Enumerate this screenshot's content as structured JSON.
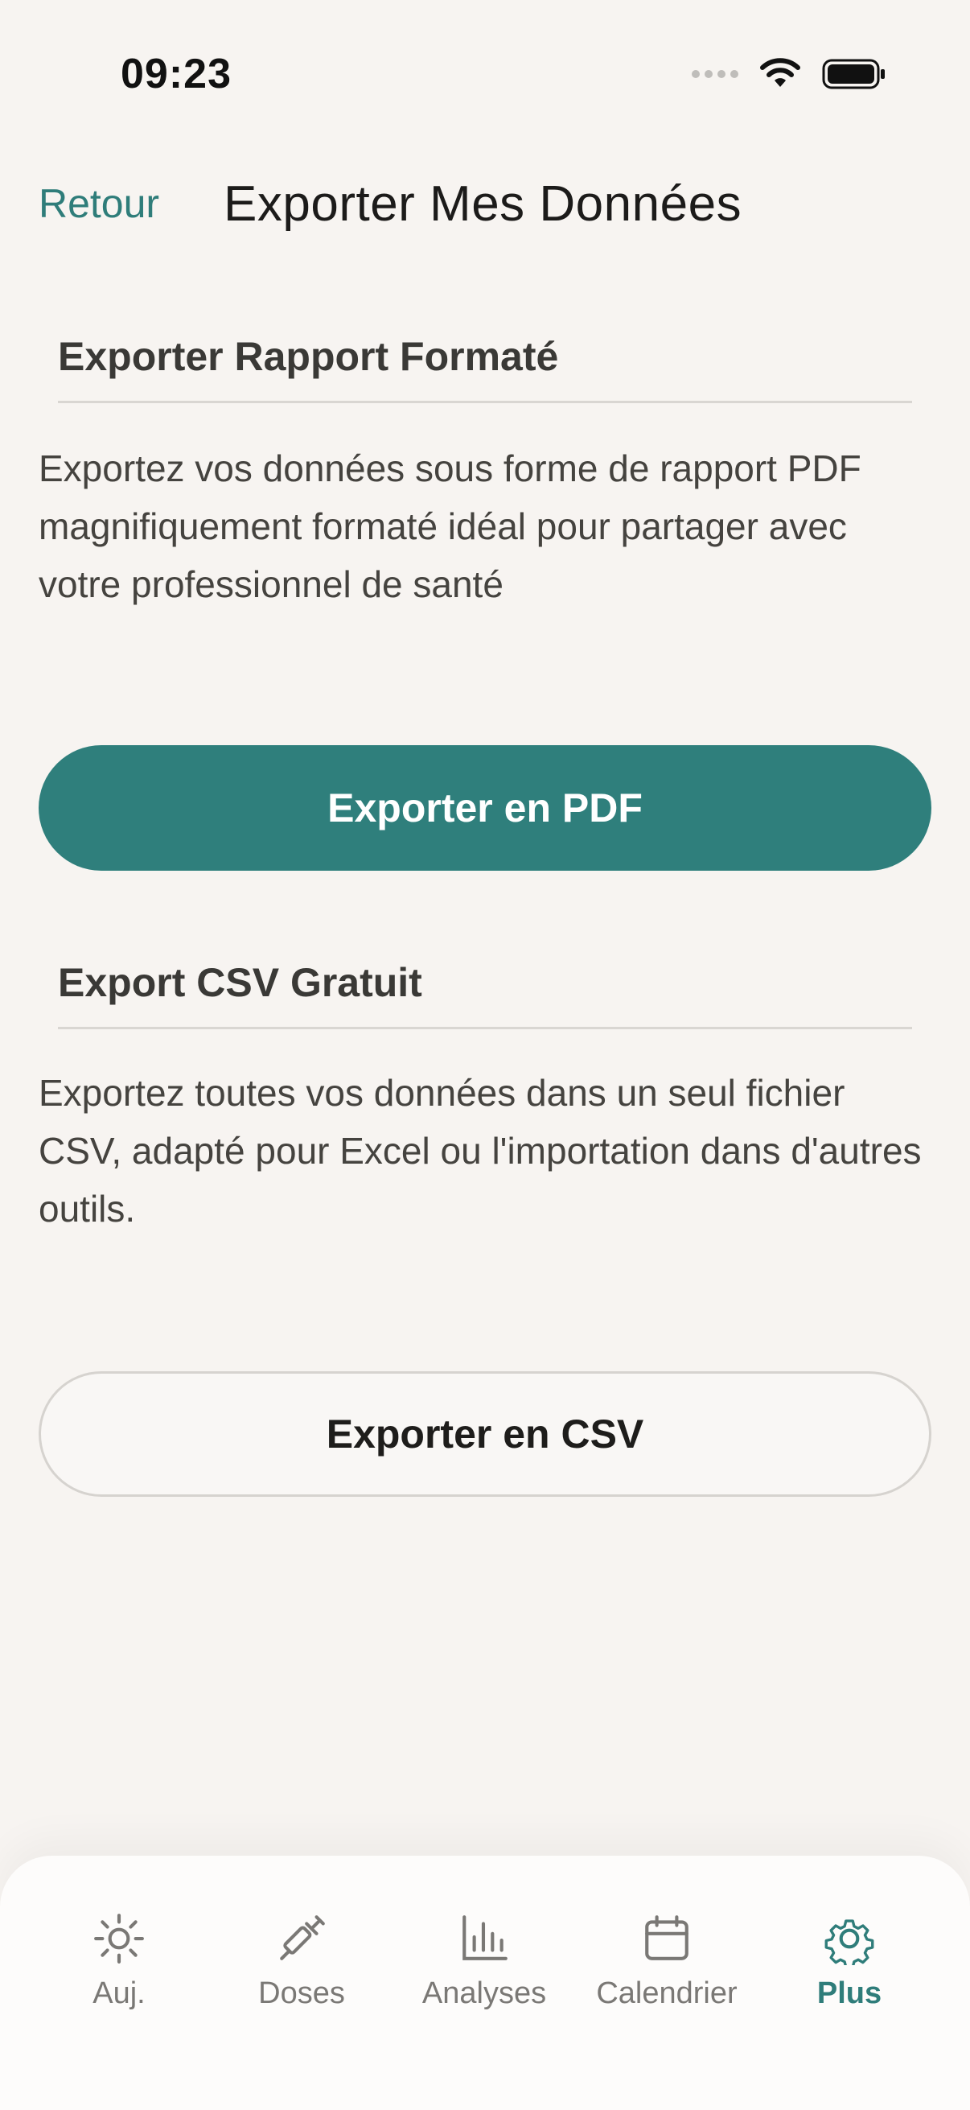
{
  "status_bar": {
    "time": "09:23"
  },
  "header": {
    "back_label": "Retour",
    "title": "Exporter Mes Données"
  },
  "sections": [
    {
      "heading": "Exporter Rapport Formaté",
      "description": "Exportez vos données sous forme de rapport PDF magnifiquement formaté idéal pour partager avec votre professionnel de santé",
      "button_label": "Exporter en PDF"
    },
    {
      "heading": "Export CSV Gratuit",
      "description": "Exportez toutes vos données dans un seul fichier CSV, adapté pour Excel ou l'importation dans d'autres outils.",
      "button_label": "Exporter en CSV"
    }
  ],
  "tab_bar": {
    "items": [
      {
        "label": "Auj.",
        "icon": "sun-icon"
      },
      {
        "label": "Doses",
        "icon": "syringe-icon"
      },
      {
        "label": "Analyses",
        "icon": "bar-chart-icon"
      },
      {
        "label": "Calendrier",
        "icon": "calendar-icon"
      },
      {
        "label": "Plus",
        "icon": "gear-icon"
      }
    ],
    "active_index": 4
  },
  "colors": {
    "accent": "#2f7d7a",
    "background": "#f7f4f1"
  }
}
